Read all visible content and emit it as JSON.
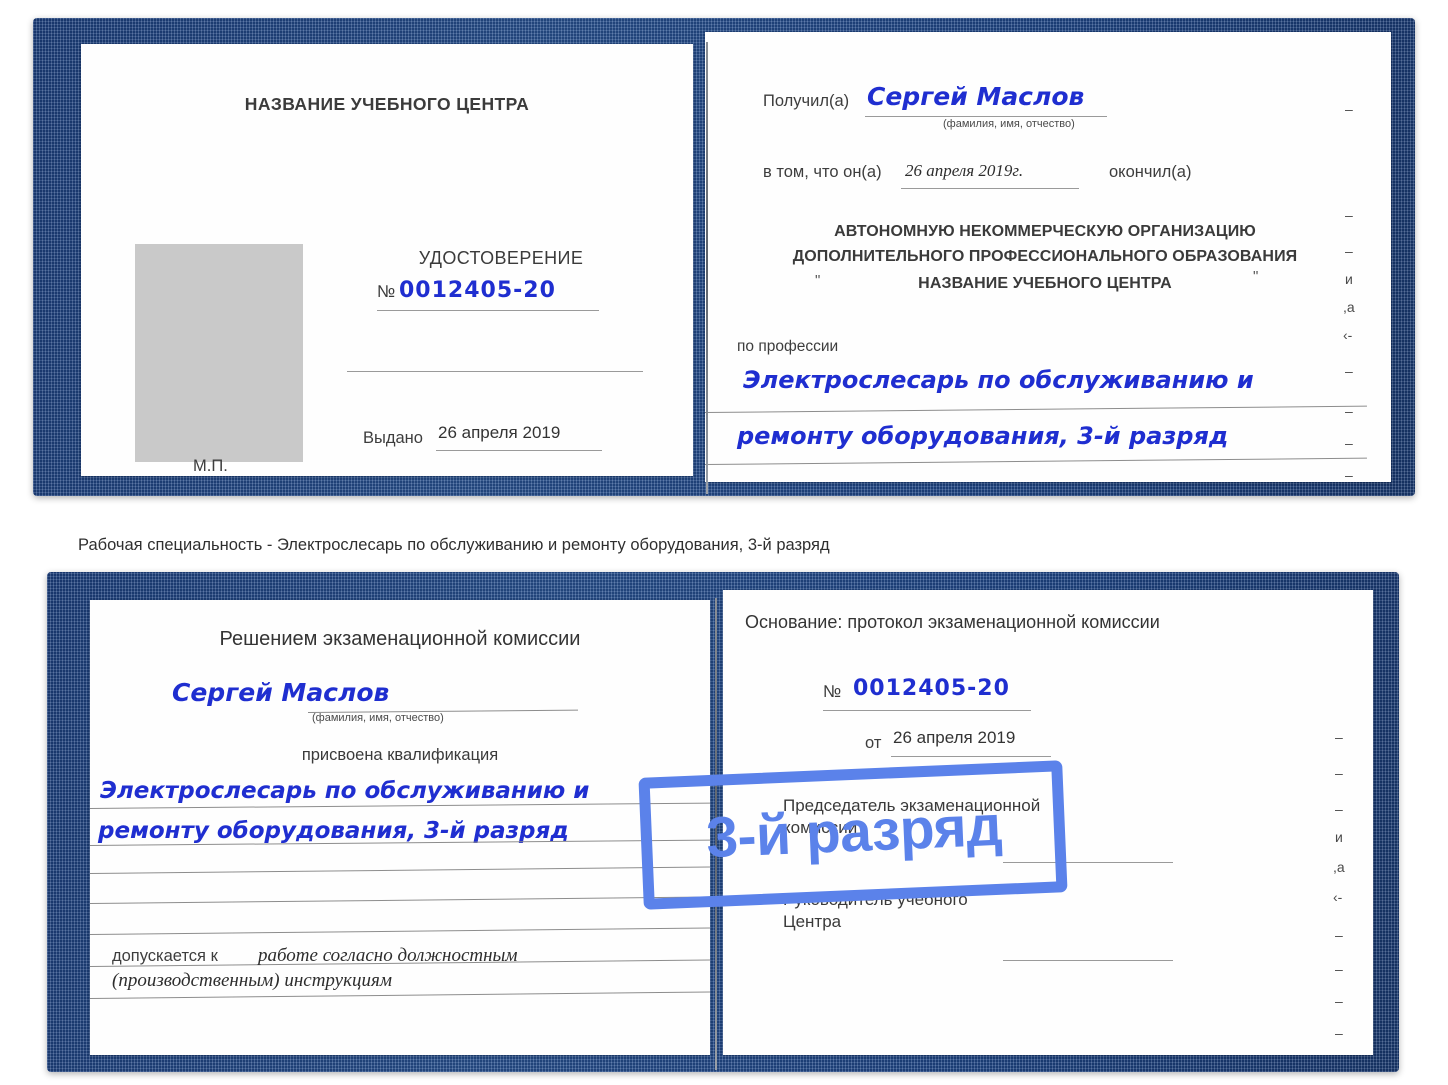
{
  "doc1": {
    "left_page": {
      "center_name": "НАЗВАНИЕ УЧЕБНОГО ЦЕНТРА",
      "cert_word": "УДОСТОВЕРЕНИЕ",
      "number_symbol": "№",
      "number_value": "0012405-20",
      "issued_label": "Выдано",
      "issued_value": "26 апреля 2019",
      "stamp_label": "М.П.",
      "photo_placeholder": "photo-placeholder"
    },
    "right_page": {
      "received_label": "Получил(а)",
      "received_value": "Сергей Маслов",
      "fio_hint": "(фамилия, имя, отчество)",
      "in_that_label": "в том, что он(а)",
      "in_that_value": "26 апреля 2019г.",
      "finished_label": "окончил(а)",
      "org_line1": "АВТОНОМНУЮ НЕКОММЕРЧЕСКУЮ ОРГАНИЗАЦИЮ",
      "org_line2": "ДОПОЛНИТЕЛЬНОГО ПРОФЕССИОНАЛЬНОГО ОБРАЗОВАНИЯ",
      "org_quote_open": "\"",
      "org_line3": "НАЗВАНИЕ УЧЕБНОГО ЦЕНТРА",
      "org_quote_close": "\"",
      "profession_label": "по профессии",
      "profession_line1": "Электрослесарь по обслуживанию и",
      "profession_line2": "ремонту оборудования, 3-й разряд",
      "edge_marks": [
        "–",
        "–",
        "–",
        "и",
        ",а",
        "‹-",
        "–",
        "–",
        "–",
        "–"
      ]
    }
  },
  "caption": "Рабочая специальность - Электрослесарь по обслуживанию и ремонту оборудования, 3-й разряд",
  "doc2": {
    "left_page": {
      "decision_title": "Решением экзаменационной комиссии",
      "name_value": "Сергей Маслов",
      "fio_hint": "(фамилия, имя, отчество)",
      "qualification_label": "присвоена квалификация",
      "qualification_line1": "Электрослесарь по обслуживанию и",
      "qualification_line2": "ремонту оборудования, 3-й разряд",
      "admitted_label": "допускается к",
      "admitted_line1": "работе согласно должностным",
      "admitted_line2": "(производственным) инструкциям"
    },
    "right_page": {
      "basis_label": "Основание: протокол экзаменационной комиссии",
      "number_symbol": "№",
      "number_value": "0012405-20",
      "from_label": "от",
      "from_value": "26 апреля 2019",
      "chair_line1": "Председатель экзаменационной",
      "chair_line2": "комиссии",
      "head_line1": "Руководитель учебного",
      "head_line2": "Центра",
      "edge_marks": [
        "–",
        "–",
        "–",
        "и",
        ",а",
        "‹-",
        "–",
        "–",
        "–",
        "–"
      ]
    }
  },
  "watermark": {
    "text": "3-й разряд",
    "color": "#5b82ea"
  },
  "colors": {
    "cover": "#1e4586",
    "ink": "#1f2ed0",
    "rule": "#9a9a9a",
    "photo": "#c9c9c9"
  }
}
